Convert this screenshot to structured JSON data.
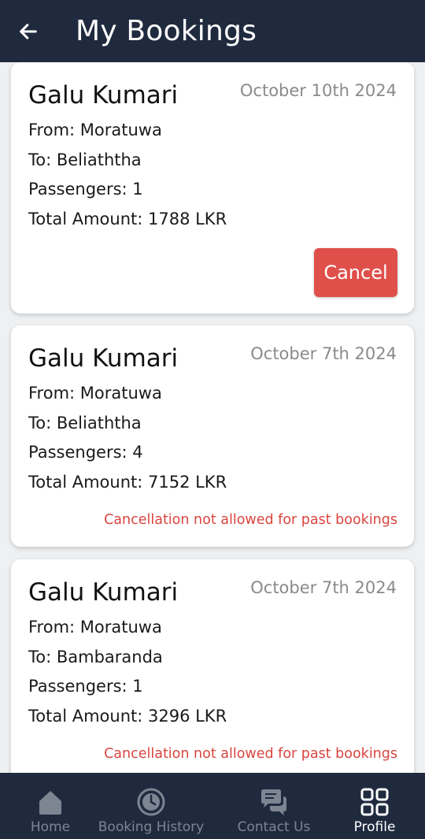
{
  "header": {
    "title": "My Bookings",
    "back_icon": "arrow-left-icon"
  },
  "bookings": [
    {
      "name": "Galu Kumari",
      "date": "October 10th 2024",
      "from": "From: Moratuwa",
      "to": "To: Beliaththa",
      "passengers": "Passengers: 1",
      "total": "Total Amount: 1788 LKR",
      "action_label": "Cancel"
    },
    {
      "name": "Galu Kumari",
      "date": "October 7th 2024",
      "from": "From: Moratuwa",
      "to": "To: Beliaththa",
      "passengers": "Passengers: 4",
      "total": "Total Amount: 7152 LKR",
      "note": "Cancellation not allowed for past bookings"
    },
    {
      "name": "Galu Kumari",
      "date": "October 7th 2024",
      "from": "From: Moratuwa",
      "to": "To: Bambaranda",
      "passengers": "Passengers: 1",
      "total": "Total Amount: 3296 LKR",
      "note": "Cancellation not allowed for past bookings"
    }
  ],
  "nav": {
    "items": [
      {
        "label": "Home",
        "icon": "home-icon",
        "active": false
      },
      {
        "label": "Booking History",
        "icon": "history-icon",
        "active": false
      },
      {
        "label": "Contact Us",
        "icon": "chat-icon",
        "active": false
      },
      {
        "label": "Profile",
        "icon": "grid-icon",
        "active": true
      }
    ]
  },
  "colors": {
    "app_bar": "#1f2a3e",
    "cancel_button": "#e0504b",
    "note_text": "#d9453f",
    "inactive_nav": "#7d8593",
    "active_nav": "#ffffff"
  }
}
